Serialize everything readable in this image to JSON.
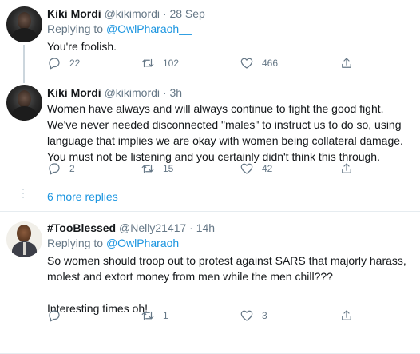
{
  "tweets": [
    {
      "name": "Kiki Mordi",
      "handle": "@kikimordi",
      "separator": "·",
      "time": "28 Sep",
      "replying_prefix": "Replying to ",
      "replying_to": "@OwlPharaoh__",
      "text": "You're foolish.",
      "replies": "22",
      "retweets": "102",
      "likes": "466"
    },
    {
      "name": "Kiki Mordi",
      "handle": "@kikimordi",
      "separator": "·",
      "time": "3h",
      "text": "Women have always and will always continue to fight the good fight. We've never needed disconnected \"males\" to instruct us to do so, using language that implies we are okay with women being collateral damage. You must not be listening and you certainly didn't think this through.",
      "replies": "2",
      "retweets": "15",
      "likes": "42"
    },
    {
      "name": "#TooBlessed",
      "handle": "@Nelly21417",
      "separator": "·",
      "time": "14h",
      "replying_prefix": "Replying to ",
      "replying_to": "@OwlPharaoh__",
      "text": "So women should troop out to protest against SARS that majorly harass, molest and extort money from men while the men chill???\n\nInteresting times oh!",
      "replies": "",
      "retweets": "1",
      "likes": "3"
    }
  ],
  "more_replies": "6 more replies",
  "icons": [
    "reply-icon",
    "retweet-icon",
    "like-icon",
    "share-icon"
  ],
  "colors": {
    "link": "#1b95e0",
    "muted": "#657786",
    "divider": "#e6ecf0"
  }
}
